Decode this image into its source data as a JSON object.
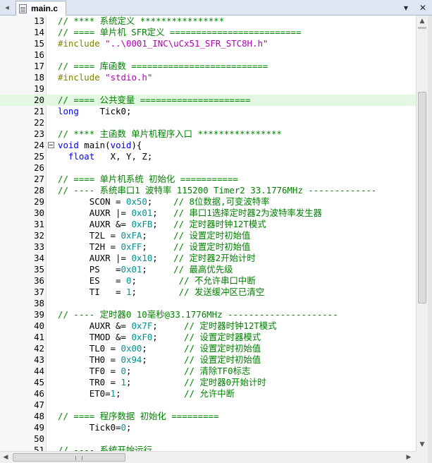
{
  "tab": {
    "filename": "main.c",
    "file_icon": "c-file-icon"
  },
  "toolbar": {
    "dropdown_glyph": "▾",
    "close_glyph": "✕",
    "left_glyph": "◂"
  },
  "editor": {
    "current_line": 20,
    "lines": [
      {
        "n": "13",
        "tokens": [
          {
            "t": "// **** 系统定义 ****************",
            "c": "c"
          }
        ]
      },
      {
        "n": "14",
        "tokens": [
          {
            "t": "// ==== 单片机 SFR定义 =========================",
            "c": "c"
          }
        ]
      },
      {
        "n": "15",
        "tokens": [
          {
            "t": "#include ",
            "c": "p"
          },
          {
            "t": "\"..\\0001_INC\\uCx51_SFR_STC8H.h\"",
            "c": "s"
          }
        ]
      },
      {
        "n": "16",
        "tokens": []
      },
      {
        "n": "17",
        "tokens": [
          {
            "t": "// ==== 库函数 ==========================",
            "c": "c"
          }
        ]
      },
      {
        "n": "18",
        "tokens": [
          {
            "t": "#include ",
            "c": "p"
          },
          {
            "t": "\"stdio.h\"",
            "c": "s"
          }
        ]
      },
      {
        "n": "19",
        "tokens": []
      },
      {
        "n": "20",
        "tokens": [
          {
            "t": "// ==== 公共变量 =====================",
            "c": "c"
          }
        ]
      },
      {
        "n": "21",
        "tokens": [
          {
            "t": "long",
            "c": "k"
          },
          {
            "t": "    Tick0;",
            "c": ""
          }
        ]
      },
      {
        "n": "22",
        "tokens": []
      },
      {
        "n": "23",
        "tokens": [
          {
            "t": "// **** 主函数 单片机程序入口 ****************",
            "c": "c"
          }
        ]
      },
      {
        "n": "24",
        "fold": true,
        "tokens": [
          {
            "t": "void",
            "c": "k"
          },
          {
            "t": " main(",
            "c": ""
          },
          {
            "t": "void",
            "c": "k"
          },
          {
            "t": "){",
            "c": ""
          }
        ]
      },
      {
        "n": "25",
        "tokens": [
          {
            "t": "  ",
            "c": ""
          },
          {
            "t": "float",
            "c": "k"
          },
          {
            "t": "   X, Y, Z;",
            "c": ""
          }
        ]
      },
      {
        "n": "26",
        "tokens": []
      },
      {
        "n": "27",
        "tokens": [
          {
            "t": "// ==== 单片机系统 初始化 ===========",
            "c": "c"
          }
        ]
      },
      {
        "n": "28",
        "tokens": [
          {
            "t": "// ---- 系统串口1 波特率 115200 Timer2 33.1776MHz -------------",
            "c": "c"
          }
        ]
      },
      {
        "n": "29",
        "tokens": [
          {
            "t": "      SCON = ",
            "c": ""
          },
          {
            "t": "0x50",
            "c": "n"
          },
          {
            "t": ";    ",
            "c": ""
          },
          {
            "t": "// 8位数据,可变波特率",
            "c": "c"
          }
        ]
      },
      {
        "n": "30",
        "tokens": [
          {
            "t": "      AUXR |= ",
            "c": ""
          },
          {
            "t": "0x01",
            "c": "n"
          },
          {
            "t": ";   ",
            "c": ""
          },
          {
            "t": "// 串口1选择定时器2为波特率发生器",
            "c": "c"
          }
        ]
      },
      {
        "n": "31",
        "tokens": [
          {
            "t": "      AUXR &= ",
            "c": ""
          },
          {
            "t": "0xFB",
            "c": "n"
          },
          {
            "t": ";   ",
            "c": ""
          },
          {
            "t": "// 定时器时钟12T模式",
            "c": "c"
          }
        ]
      },
      {
        "n": "32",
        "tokens": [
          {
            "t": "      T2L = ",
            "c": ""
          },
          {
            "t": "0xFA",
            "c": "n"
          },
          {
            "t": ";     ",
            "c": ""
          },
          {
            "t": "// 设置定时初始值",
            "c": "c"
          }
        ]
      },
      {
        "n": "33",
        "tokens": [
          {
            "t": "      T2H = ",
            "c": ""
          },
          {
            "t": "0xFF",
            "c": "n"
          },
          {
            "t": ";     ",
            "c": ""
          },
          {
            "t": "// 设置定时初始值",
            "c": "c"
          }
        ]
      },
      {
        "n": "34",
        "tokens": [
          {
            "t": "      AUXR |= ",
            "c": ""
          },
          {
            "t": "0x10",
            "c": "n"
          },
          {
            "t": ";   ",
            "c": ""
          },
          {
            "t": "// 定时器2开始计时",
            "c": "c"
          }
        ]
      },
      {
        "n": "35",
        "tokens": [
          {
            "t": "      PS   =",
            "c": ""
          },
          {
            "t": "0x01",
            "c": "n"
          },
          {
            "t": ";     ",
            "c": ""
          },
          {
            "t": "// 最高优先级",
            "c": "c"
          }
        ]
      },
      {
        "n": "36",
        "tokens": [
          {
            "t": "      ES   = ",
            "c": ""
          },
          {
            "t": "0",
            "c": "n"
          },
          {
            "t": ";        ",
            "c": ""
          },
          {
            "t": "// 不允许串口中断",
            "c": "c"
          }
        ]
      },
      {
        "n": "37",
        "tokens": [
          {
            "t": "      TI   = ",
            "c": ""
          },
          {
            "t": "1",
            "c": "n"
          },
          {
            "t": ";        ",
            "c": ""
          },
          {
            "t": "// 发送缓冲区已清空",
            "c": "c"
          }
        ]
      },
      {
        "n": "38",
        "tokens": []
      },
      {
        "n": "39",
        "tokens": [
          {
            "t": "// ---- 定时器0 10毫秒@33.1776MHz ---------------------",
            "c": "c"
          }
        ]
      },
      {
        "n": "40",
        "tokens": [
          {
            "t": "      AUXR &= ",
            "c": ""
          },
          {
            "t": "0x7F",
            "c": "n"
          },
          {
            "t": ";     ",
            "c": ""
          },
          {
            "t": "// 定时器时钟12T模式",
            "c": "c"
          }
        ]
      },
      {
        "n": "41",
        "tokens": [
          {
            "t": "      TMOD &= ",
            "c": ""
          },
          {
            "t": "0xF0",
            "c": "n"
          },
          {
            "t": ";     ",
            "c": ""
          },
          {
            "t": "// 设置定时器模式",
            "c": "c"
          }
        ]
      },
      {
        "n": "42",
        "tokens": [
          {
            "t": "      TL0 = ",
            "c": ""
          },
          {
            "t": "0x00",
            "c": "n"
          },
          {
            "t": ";       ",
            "c": ""
          },
          {
            "t": "// 设置定时初始值",
            "c": "c"
          }
        ]
      },
      {
        "n": "43",
        "tokens": [
          {
            "t": "      TH0 = ",
            "c": ""
          },
          {
            "t": "0x94",
            "c": "n"
          },
          {
            "t": ";       ",
            "c": ""
          },
          {
            "t": "// 设置定时初始值",
            "c": "c"
          }
        ]
      },
      {
        "n": "44",
        "tokens": [
          {
            "t": "      TF0 = ",
            "c": ""
          },
          {
            "t": "0",
            "c": "n"
          },
          {
            "t": ";          ",
            "c": ""
          },
          {
            "t": "// 清除TF0标志",
            "c": "c"
          }
        ]
      },
      {
        "n": "45",
        "tokens": [
          {
            "t": "      TR0 = ",
            "c": ""
          },
          {
            "t": "1",
            "c": "n"
          },
          {
            "t": ";          ",
            "c": ""
          },
          {
            "t": "// 定时器0开始计时",
            "c": "c"
          }
        ]
      },
      {
        "n": "46",
        "tokens": [
          {
            "t": "      ET0=",
            "c": ""
          },
          {
            "t": "1",
            "c": "n"
          },
          {
            "t": ";            ",
            "c": ""
          },
          {
            "t": "// 允许中断",
            "c": "c"
          }
        ]
      },
      {
        "n": "47",
        "tokens": []
      },
      {
        "n": "48",
        "tokens": [
          {
            "t": "// ==== 程序数据 初始化 =========",
            "c": "c"
          }
        ]
      },
      {
        "n": "49",
        "tokens": [
          {
            "t": "      Tick0=",
            "c": ""
          },
          {
            "t": "0",
            "c": "n"
          },
          {
            "t": ";",
            "c": ""
          }
        ]
      },
      {
        "n": "50",
        "tokens": []
      },
      {
        "n": "51",
        "tokens": [
          {
            "t": "// ---- 系统开始运行",
            "c": "c"
          }
        ]
      }
    ]
  },
  "scrollbars": {
    "up_glyph": "▲",
    "down_glyph": "▼",
    "left_glyph": "◀",
    "right_glyph": "▶"
  },
  "colors": {
    "comment": "#008000",
    "keyword": "#0000ff",
    "preprocessor": "#808000",
    "string": "#b000b0",
    "number": "#009090",
    "current_line": "#e3f7e3"
  }
}
